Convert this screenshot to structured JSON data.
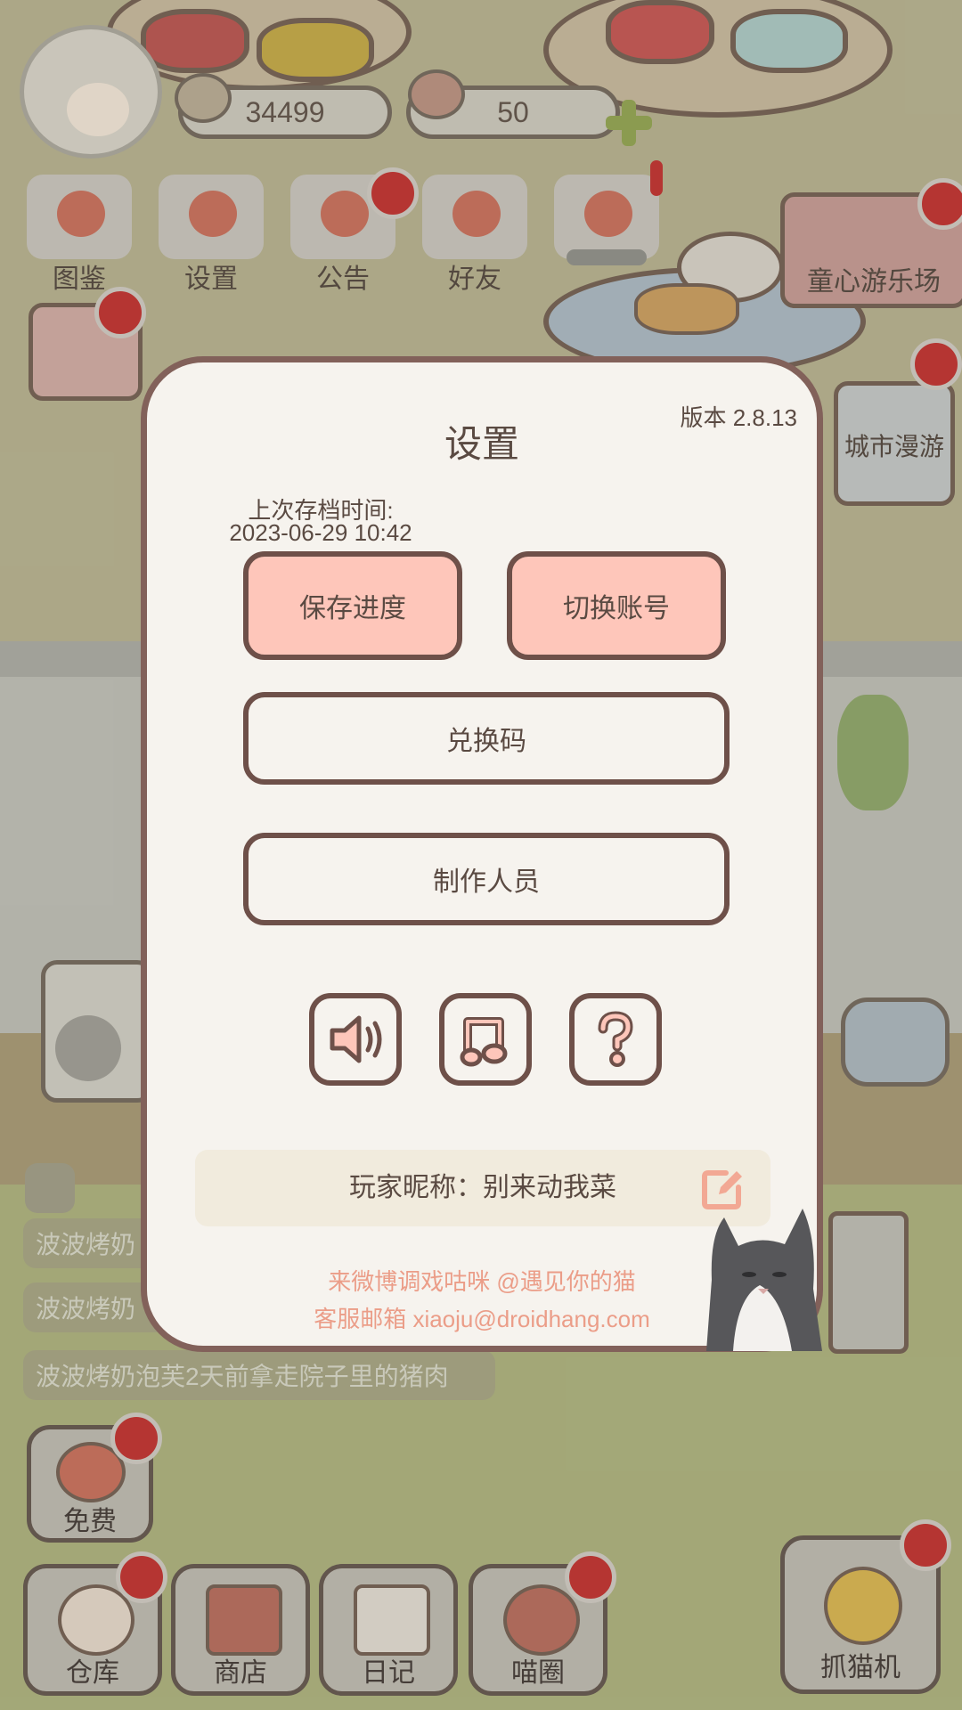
{
  "hud": {
    "coins": "34499",
    "hearts": "50",
    "menu": [
      {
        "label": "图鉴",
        "icon": "cat-head-icon"
      },
      {
        "label": "设置",
        "icon": "gear-icon"
      },
      {
        "label": "公告",
        "icon": "gift-icon"
      },
      {
        "label": "好友",
        "icon": "friends-icon"
      },
      {
        "label": "",
        "icon": "heart-paw-icon"
      }
    ],
    "amusement_park": "童心游乐场",
    "city_tour": "城市漫游"
  },
  "activity_feed": [
    "波波烤奶",
    "波波烤奶",
    "波波烤奶泡芙2天前拿走院子里的猪肉"
  ],
  "bottom_bar": {
    "free": "免费",
    "warehouse": "仓库",
    "shop": "商店",
    "diary": "日记",
    "meow_circle": "喵圈",
    "claw_machine": "抓猫机"
  },
  "settings": {
    "title": "设置",
    "version": "版本 2.8.13",
    "last_save_label": "上次存档时间:",
    "last_save_time": "2023-06-29 10:42",
    "save_button": "保存进度",
    "switch_account_button": "切换账号",
    "redeem_code_button": "兑换码",
    "credits_button": "制作人员",
    "icons": [
      "sound-icon",
      "music-note-icon",
      "help-question-icon"
    ],
    "nickname": "玩家昵称：别来动我菜",
    "weibo": "来微博调戏咕咪 @遇见你的猫",
    "email": "客服邮箱 xiaoju@droidhang.com"
  },
  "colors": {
    "dialog_bg": "#f6f3ee",
    "dialog_border": "#82615a",
    "pink_button": "#fec6ba",
    "text": "#5a4a42",
    "contact_text": "#eb9d88",
    "badge_red": "#c02a28"
  }
}
